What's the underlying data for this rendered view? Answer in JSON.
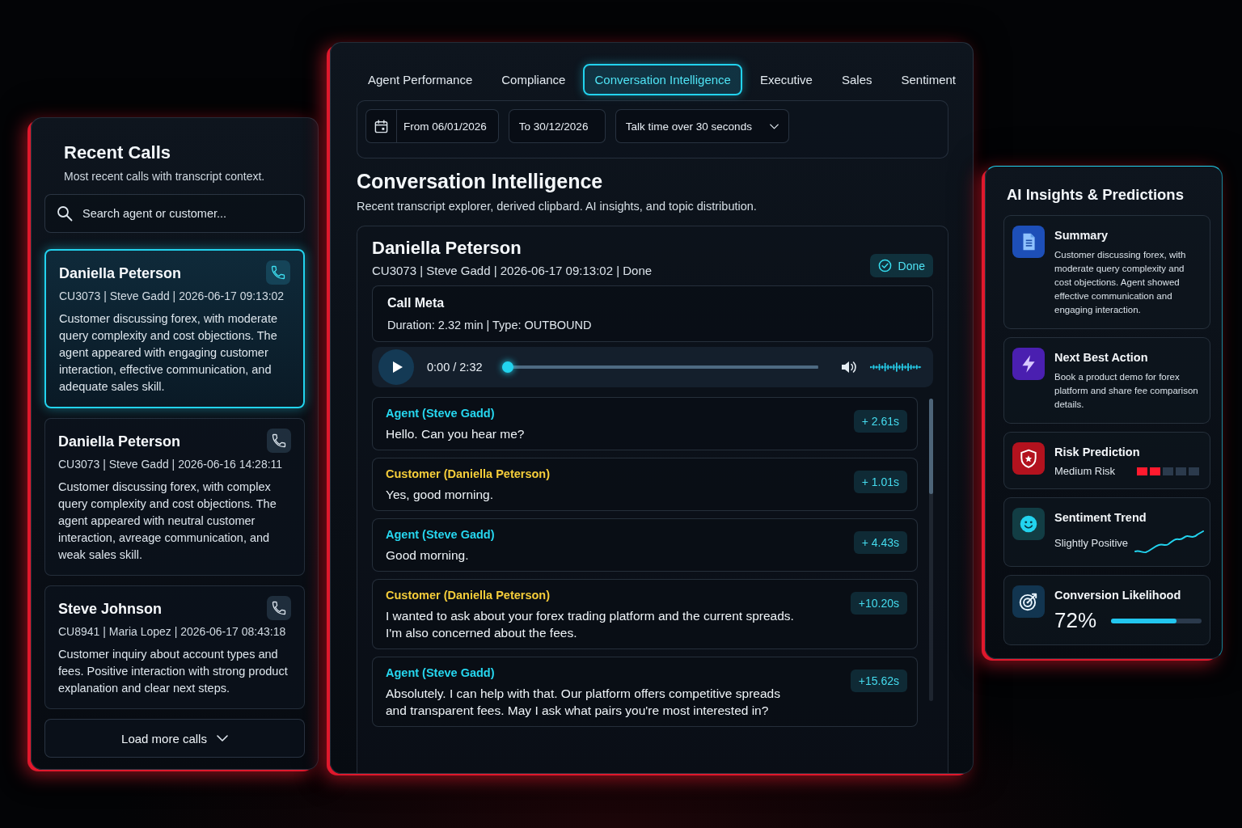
{
  "recent_calls": {
    "title": "Recent Calls",
    "subtitle": "Most recent calls with transcript context.",
    "search": {
      "placeholder": "Search agent or customer..."
    },
    "calls": [
      {
        "name": "Daniella Peterson",
        "meta": "CU3073 | Steve Gadd | 2026-06-17 09:13:02",
        "summary": "Customer discussing forex, with moderate query complexity and cost objections. The agent appeared with engaging customer interaction, effective communication, and adequate sales skill.",
        "selected": true
      },
      {
        "name": "Daniella Peterson",
        "meta": "CU3073 | Steve Gadd | 2026-06-16 14:28:11",
        "summary": "Customer discussing forex, with complex query complexity and cost objections. The agent appeared with neutral customer interaction, avreage communication, and weak sales skill.",
        "selected": false
      },
      {
        "name": "Steve Johnson",
        "meta": "CU8941 | Maria Lopez | 2026-06-17 08:43:18",
        "summary": "Customer inquiry about account types and fees. Positive interaction with strong product explanation and clear next steps.",
        "selected": false
      }
    ],
    "load_more": "Load more calls"
  },
  "dashboard": {
    "tabs": [
      {
        "label": "Agent Performance",
        "selected": false
      },
      {
        "label": "Compliance",
        "selected": false
      },
      {
        "label": "Conversation Intelligence",
        "selected": true
      },
      {
        "label": "Executive",
        "selected": false
      },
      {
        "label": "Sales",
        "selected": false
      },
      {
        "label": "Sentiment",
        "selected": false
      }
    ],
    "filters": {
      "from": "From 06/01/2026",
      "to": "To 30/12/2026",
      "talk_time": "Talk time over 30 seconds"
    },
    "title": "Conversation Intelligence",
    "subtitle": "Recent transcript explorer, derived clipbard. AI insights, and topic distribution.",
    "call": {
      "name": "Daniella Peterson",
      "meta": "CU3073 | Steve Gadd | 2026-06-17 09:13:02 | Done",
      "status": "Done"
    },
    "call_meta": {
      "title": "Call Meta",
      "details": "Duration: 2.32 min | Type: OUTBOUND"
    },
    "player": {
      "time": "0:00 / 2:32",
      "level": 0
    },
    "transcript": [
      {
        "kind": "agent",
        "speaker": "Agent (Steve Gadd)",
        "text": "Hello. Can you hear me?",
        "offset": "+ 2.61s"
      },
      {
        "kind": "customer",
        "speaker": "Customer (Daniella Peterson)",
        "text": "Yes, good morning.",
        "offset": "+ 1.01s"
      },
      {
        "kind": "agent",
        "speaker": "Agent (Steve Gadd)",
        "text": "Good morning.",
        "offset": "+ 4.43s"
      },
      {
        "kind": "customer",
        "speaker": "Customer (Daniella Peterson)",
        "text": "I wanted to ask about your forex trading platform and the current spreads. I'm also concerned about the fees.",
        "offset": "+10.20s"
      },
      {
        "kind": "agent",
        "speaker": "Agent (Steve Gadd)",
        "text": "Absolutely. I can help with that. Our platform offers competitive spreads and transparent fees. May I ask what pairs you're most interested in?",
        "offset": "+15.62s"
      }
    ]
  },
  "insights": {
    "title": "AI Insights & Predictions",
    "cards": [
      {
        "kind": "summary",
        "title": "Summary",
        "text": "Customer discussing forex, with moderate query complexity and cost objections. Agent showed effective communication and engaging interaction."
      },
      {
        "kind": "action",
        "title": "Next Best Action",
        "text": "Book a product demo for forex platform and share fee comparison details."
      },
      {
        "kind": "risk",
        "title": "Risk Prediction",
        "text": "Medium Risk",
        "level": 0.4
      },
      {
        "kind": "sentiment",
        "title": "Sentiment Trend",
        "text": "Slightly Positive"
      },
      {
        "kind": "conversion",
        "title": "Conversion Likelihood",
        "text": "72%",
        "level": 0.72
      }
    ]
  }
}
